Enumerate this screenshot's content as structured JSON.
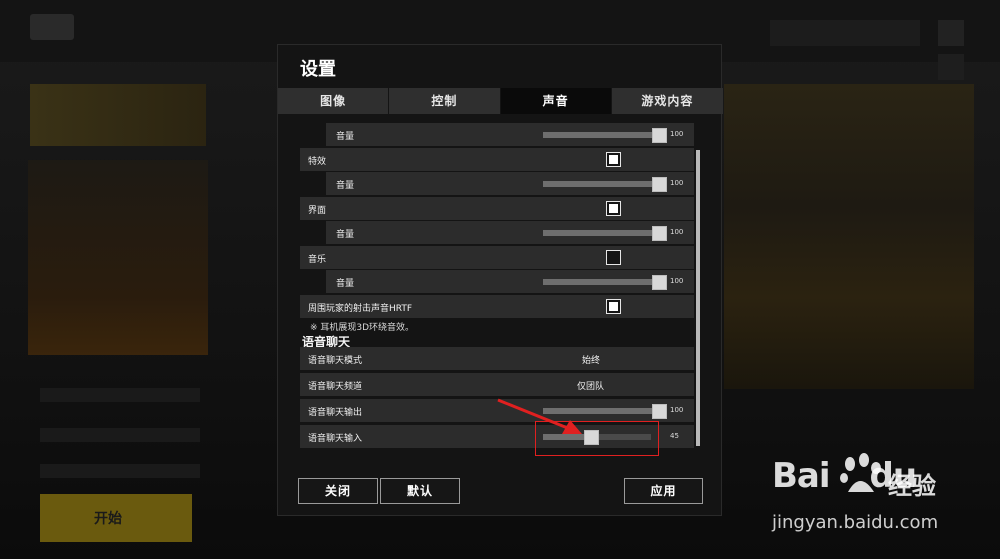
{
  "dialog": {
    "title": "设置",
    "tabs": [
      {
        "label": "图像",
        "active": false
      },
      {
        "label": "控制",
        "active": false
      },
      {
        "label": "声音",
        "active": true
      },
      {
        "label": "游戏内容",
        "active": false
      }
    ],
    "rows": {
      "volume_top": {
        "label": "音量",
        "value": "100",
        "level": 1.0
      },
      "effects": {
        "label": "特效",
        "checked": true
      },
      "effects_volume": {
        "label": "音量",
        "value": "100",
        "level": 1.0
      },
      "interface": {
        "label": "界面",
        "checked": true
      },
      "interface_volume": {
        "label": "音量",
        "value": "100",
        "level": 1.0
      },
      "music": {
        "label": "音乐",
        "checked": false
      },
      "music_volume": {
        "label": "音量",
        "value": "100",
        "level": 1.0
      },
      "hrtf": {
        "label": "周围玩家的射击声音HRTF",
        "checked": true
      },
      "hrtf_note": "※ 耳机展现3D环绕音效。"
    },
    "voice_chat": {
      "section_title": "语音聊天",
      "mode": {
        "label": "语音聊天模式",
        "value": "始终"
      },
      "channel": {
        "label": "语音聊天频道",
        "value": "仅团队"
      },
      "output": {
        "label": "语音聊天输出",
        "value": "100",
        "level": 1.0
      },
      "input": {
        "label": "语音聊天输入",
        "value": "45",
        "level": 0.45
      }
    },
    "buttons": {
      "close": "关闭",
      "default": "默认",
      "apply": "应用"
    }
  },
  "watermark": {
    "logo": "Bai",
    "logo_tail": "du",
    "cn": "经验",
    "url": "jingyan.baidu.com"
  },
  "background": {
    "start_label": "开始"
  },
  "colors": {
    "annotation": "#e02020",
    "dialog_bg": "#141414",
    "row_bg": "#2c2c2c",
    "active_tab": "#0a0a0a"
  }
}
